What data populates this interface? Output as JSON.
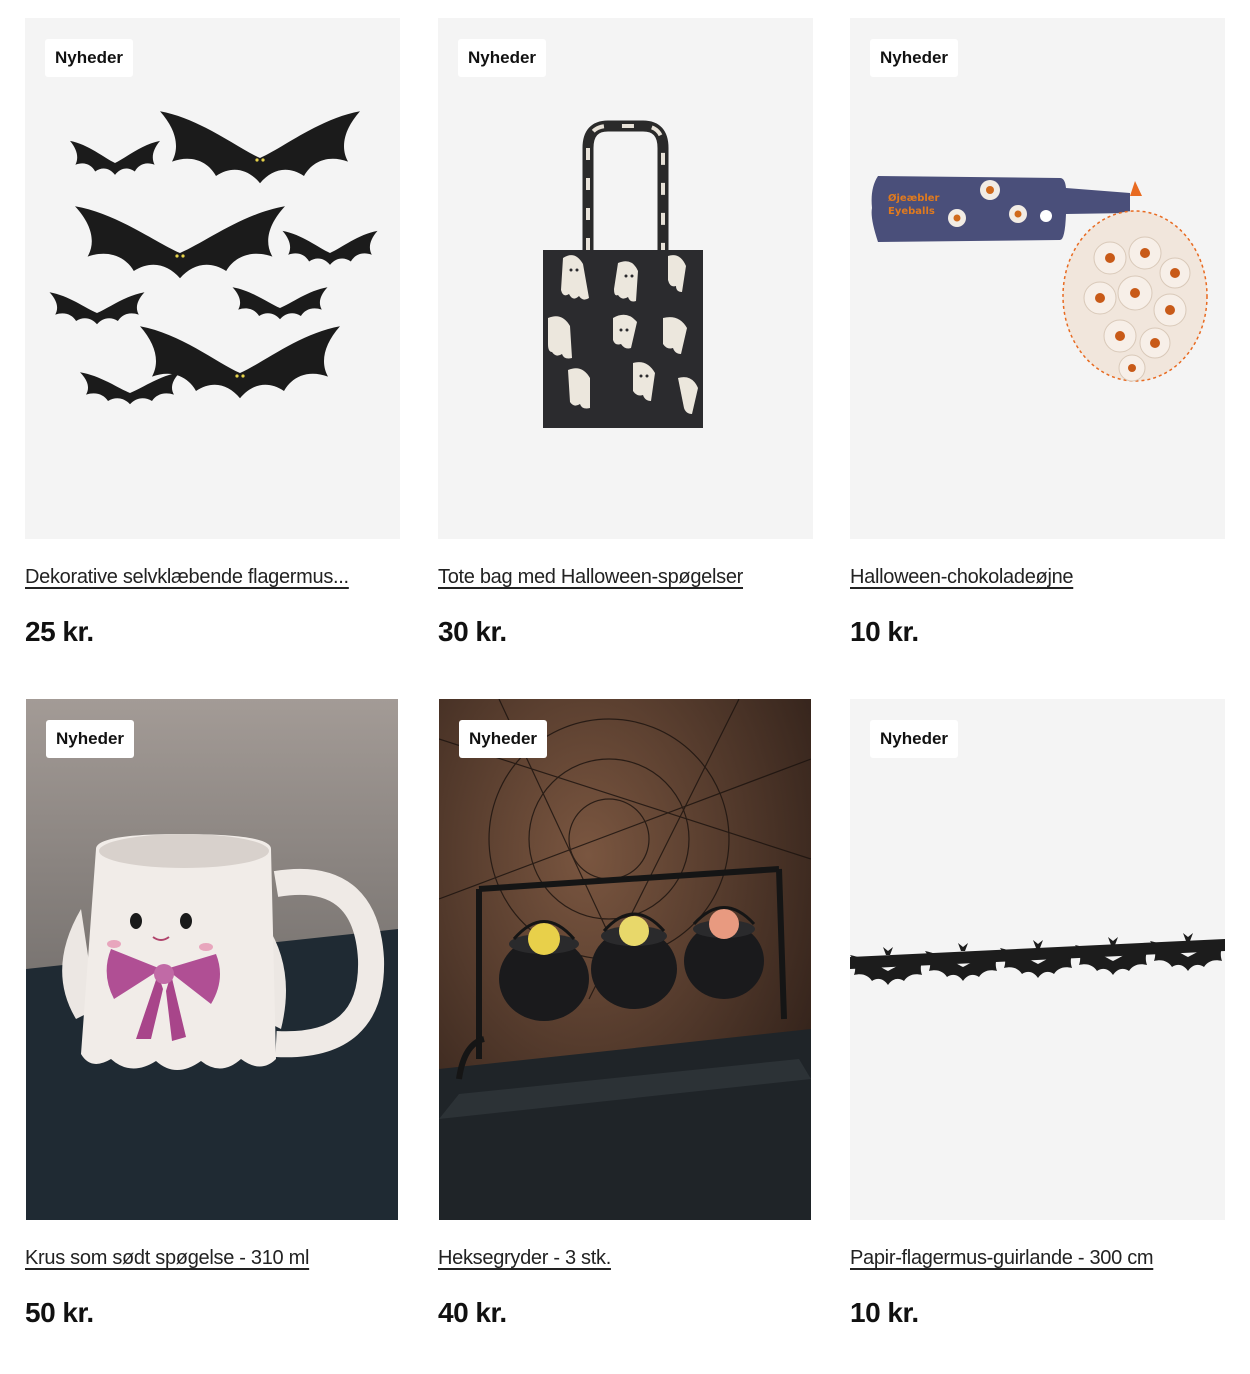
{
  "badge_label": "Nyheder",
  "products": [
    {
      "title": "Dekorative selvklæbende flagermus...",
      "price": "25 kr.",
      "badge": "Nyheder"
    },
    {
      "title": "Tote bag med Halloween-spøgelser",
      "price": "30 kr.",
      "badge": "Nyheder"
    },
    {
      "title": "Halloween-chokoladeøjne",
      "price": "10 kr.",
      "badge": "Nyheder",
      "package_text": "Øjeæbler\nEyeballs"
    },
    {
      "title": "Krus som sødt spøgelse - 310 ml",
      "price": "50 kr.",
      "badge": "Nyheder"
    },
    {
      "title": "Heksegryder - 3 stk.",
      "price": "40 kr.",
      "badge": "Nyheder"
    },
    {
      "title": "Papir-flagermus-guirlande - 300 cm",
      "price": "10 kr.",
      "badge": "Nyheder"
    }
  ],
  "colors": {
    "tile_bg": "#f4f4f4",
    "price": "#111111",
    "badge_bg": "#ffffff"
  }
}
